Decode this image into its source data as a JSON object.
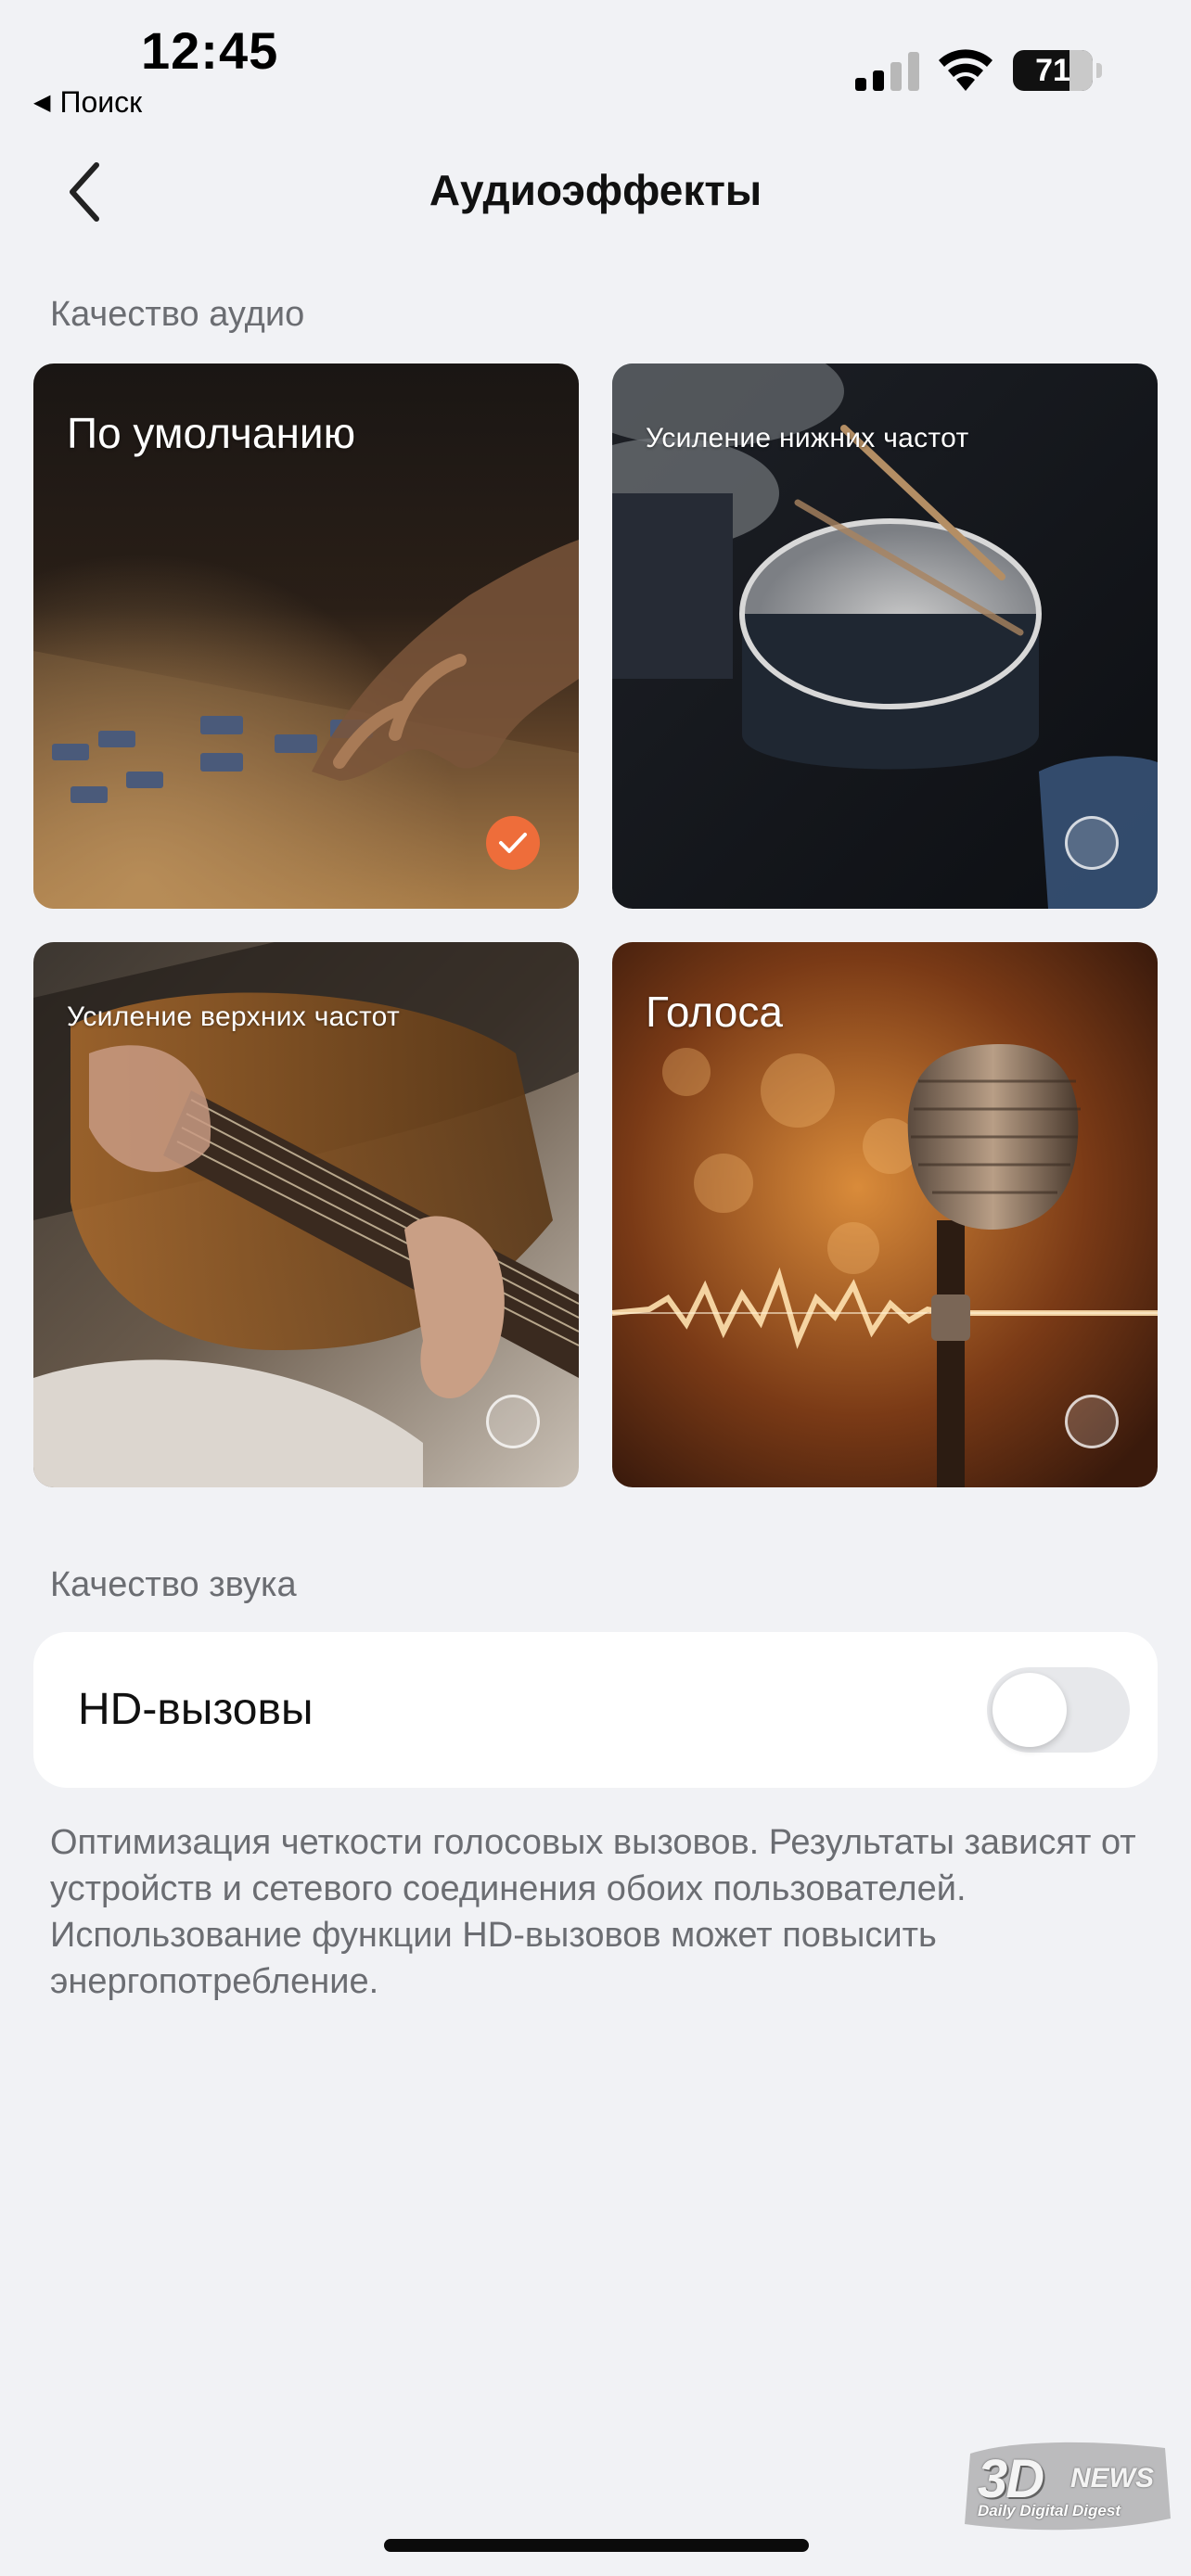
{
  "status_bar": {
    "time": "12:45",
    "back_to": "Поиск",
    "battery": "71"
  },
  "nav": {
    "title": "Аудиоэффекты"
  },
  "audio_quality": {
    "section_label": "Качество аудио",
    "effects": [
      {
        "label": "По умолчанию",
        "selected": true,
        "icon": "mixing-console-photo"
      },
      {
        "label": "Усиление нижних частот",
        "selected": false,
        "icon": "drums-photo"
      },
      {
        "label": "Усиление верхних частот",
        "selected": false,
        "icon": "guitar-photo"
      },
      {
        "label": "Голоса",
        "selected": false,
        "icon": "microphone-photo"
      }
    ]
  },
  "sound_quality": {
    "section_label": "Качество звука",
    "hd_calls": {
      "label": "HD-вызовы",
      "enabled": false
    },
    "description": "Оптимизация четкости голосовых вызовов. Результаты зависят от устройств и сетевого соединения обоих пользователей. Использование функции HD-вызовов может повысить энергопотребление."
  },
  "watermark": {
    "brand": "3D",
    "news": "NEWS",
    "tagline": "Daily Digital Digest"
  },
  "colors": {
    "accent": "#ee6d3a",
    "background": "#f1f2f5",
    "card_background": "#ffffff",
    "secondary_text": "#6b6d72"
  }
}
